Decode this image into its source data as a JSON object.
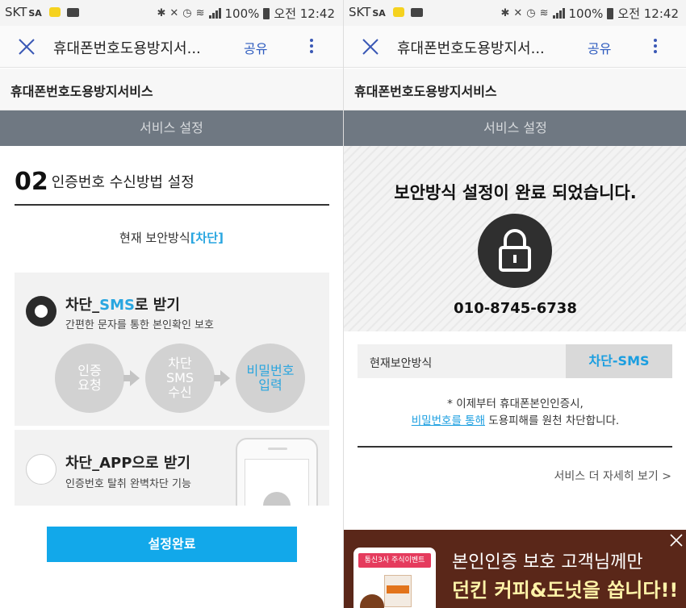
{
  "status_bar": {
    "carrier": "SKT",
    "carrier_sub": "SA",
    "battery": "100%",
    "time": "오전 12:42"
  },
  "app_bar": {
    "title": "휴대폰번호도용방지서...",
    "share": "공유"
  },
  "subheader": "휴대폰번호도용방지서비스",
  "section_bar": "서비스 설정",
  "left": {
    "step_number": "02",
    "step_title": "인증번호 수신방법 설정",
    "current_label": "현재 보안방식",
    "current_value": "[차단]",
    "option_sms": {
      "title_prefix": "차단_",
      "title_highlight": "SMS",
      "title_suffix": "로 받기",
      "description": "간편한 문자를 통한 본인확인 보호",
      "selected": true,
      "steps": [
        {
          "line1": "인증",
          "line2": "요청",
          "line3": ""
        },
        {
          "line1": "차단",
          "line2": "SMS",
          "line3": "수신"
        },
        {
          "line1": "비밀번호",
          "line2": "입력",
          "line3": ""
        }
      ]
    },
    "option_app": {
      "title": "차단_APP으로 받기",
      "description": "인증번호 탈취 완벽차단 기능",
      "selected": false
    },
    "confirm_button": "설정완료"
  },
  "right": {
    "complete_message": "보안방식 설정이 완료 되었습니다.",
    "phone_number": "010-8745-6738",
    "current_security_label": "현재보안방식",
    "current_security_value": "차단-SMS",
    "notice_line1": "* 이제부터 휴대폰본인인증시,",
    "notice_link": "비밀번호를 통해",
    "notice_line2_rest": " 도용피해를 원천 차단합니다.",
    "more_link": "서비스 더 자세히 보기 >",
    "banner": {
      "card_label": "통신3사 주식이벤트",
      "line1": "본인인증 보호 고객님께만",
      "line2": "던킨 커피&도넛을 쏩니다!!"
    }
  },
  "colors": {
    "accent_blue": "#29a6e0",
    "button_blue": "#12a8ea",
    "section_bar": "#6f7882",
    "banner_bg": "#5a2719"
  }
}
